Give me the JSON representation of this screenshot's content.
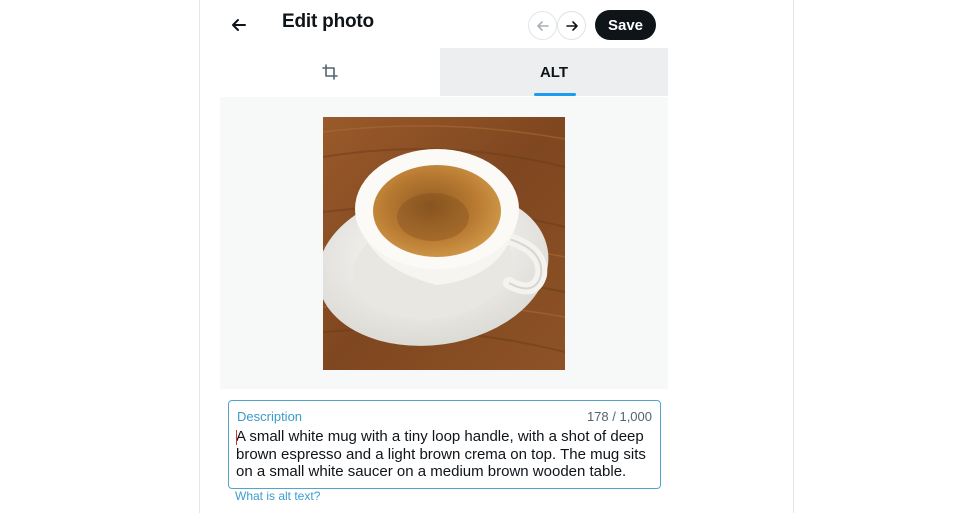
{
  "header": {
    "title": "Edit photo",
    "save_label": "Save"
  },
  "tabs": [
    {
      "id": "crop",
      "icon": "crop-icon",
      "label": ""
    },
    {
      "id": "alt",
      "label": "ALT",
      "selected": true
    }
  ],
  "alt_editor": {
    "label": "Description",
    "char_count": "178 / 1,000",
    "value": "A small white mug with a tiny loop handle, with a shot of deep brown espresso and a light brown crema on top. The mug sits on a small white saucer on a medium brown wooden table.",
    "help_link": "What is alt text?"
  },
  "colors": {
    "accent": "#1d9bf0",
    "field_border": "#53a5cb",
    "save_bg": "#0f1419",
    "selected_tab_bg": "#eceeef",
    "table_wood": "#8a4f22"
  }
}
